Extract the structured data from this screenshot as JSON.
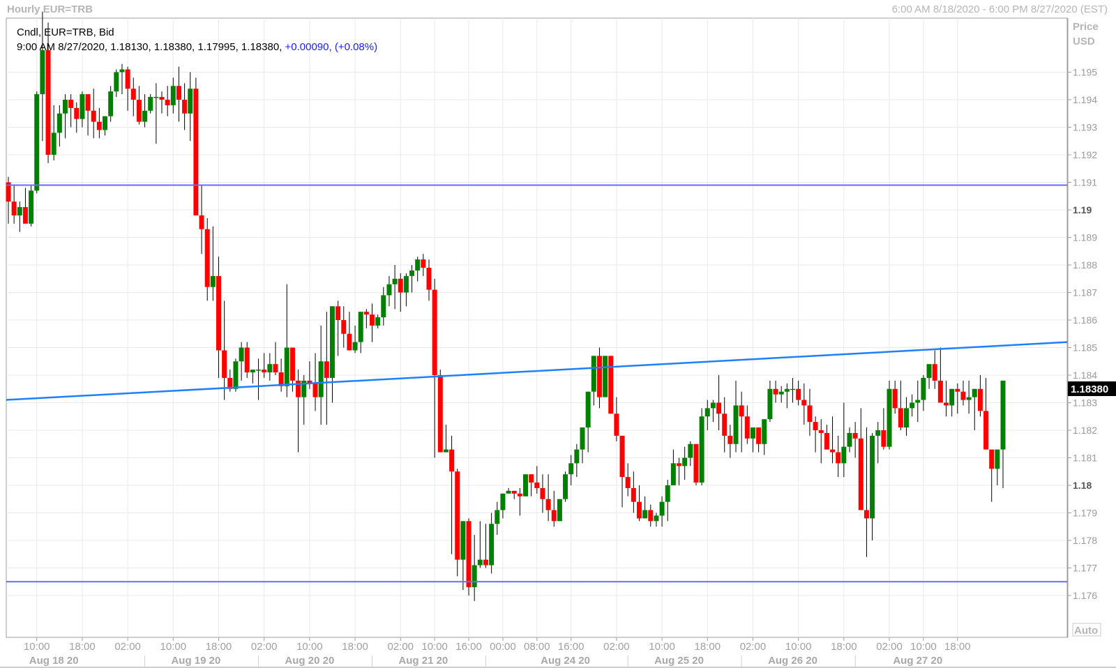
{
  "header": {
    "title": "Hourly EUR=TRB",
    "range": "6:00 AM 8/18/2020 - 6:00 PM 8/27/2020 (EST)"
  },
  "legend": {
    "line1": "Cndl, EUR=TRB, Bid",
    "line2_ohlc": "9:00 AM 8/27/2020, 1.18130, 1.18380, 1.17995, 1.18380,",
    "line2_change": "+0.00090, (+0.08%)"
  },
  "axis": {
    "price_label_1": "Price",
    "price_label_2": "USD",
    "auto_label": "Auto",
    "last_price": "1.18380"
  },
  "colors": {
    "up": "#008000",
    "down": "#ff0000",
    "hline": "#6a6aff",
    "trendline": "#1e7fff",
    "grid": "#e9e9e9"
  },
  "chart_data": {
    "type": "candlestick",
    "title": "Hourly EUR=TRB",
    "ylabel": "Price USD",
    "ylim": [
      1.1755,
      1.1963
    ],
    "y_ticks": [
      "1.195",
      "1.194",
      "1.193",
      "1.192",
      "1.191",
      "1.19",
      "1.189",
      "1.188",
      "1.187",
      "1.186",
      "1.185",
      "1.184",
      "1.183",
      "1.182",
      "1.181",
      "1.18",
      "1.179",
      "1.178",
      "1.177",
      "1.176"
    ],
    "x_time_labels": [
      "10:00",
      "18:00",
      "02:00",
      "10:00",
      "18:00",
      "02:00",
      "10:00",
      "18:00",
      "02:00",
      "10:00",
      "16:00",
      "00:00",
      "08:00",
      "16:00",
      "02:00",
      "10:00",
      "18:00",
      "02:00",
      "10:00",
      "18:00",
      "02:00",
      "10:00",
      "18:00"
    ],
    "x_date_labels": [
      "Aug 18 20",
      "Aug 19 20",
      "Aug 20 20",
      "Aug 21 20",
      "Aug 24 20",
      "Aug 25 20",
      "Aug 26 20",
      "Aug 27 20"
    ],
    "last_price": 1.1838,
    "horizontal_lines": [
      1.1909,
      1.1765
    ],
    "trendline": {
      "start": 1.1831,
      "end": 1.1852
    },
    "candles": [
      [
        1.191,
        1.1912,
        1.1895,
        1.1903
      ],
      [
        1.1903,
        1.1909,
        1.1895,
        1.1898
      ],
      [
        1.1898,
        1.1903,
        1.1892,
        1.1901
      ],
      [
        1.1901,
        1.1908,
        1.1896,
        1.1895
      ],
      [
        1.1895,
        1.1909,
        1.1894,
        1.1907
      ],
      [
        1.1907,
        1.1943,
        1.1906,
        1.1942
      ],
      [
        1.1942,
        1.1972,
        1.1925,
        1.1958
      ],
      [
        1.1958,
        1.1968,
        1.1917,
        1.192
      ],
      [
        1.192,
        1.1938,
        1.1918,
        1.1928
      ],
      [
        1.1928,
        1.1938,
        1.1923,
        1.1935
      ],
      [
        1.1935,
        1.1942,
        1.1926,
        1.194
      ],
      [
        1.194,
        1.1942,
        1.193,
        1.1937
      ],
      [
        1.1937,
        1.1939,
        1.1928,
        1.1933
      ],
      [
        1.1933,
        1.1943,
        1.193,
        1.1942
      ],
      [
        1.1942,
        1.1942,
        1.1927,
        1.1936
      ],
      [
        1.1936,
        1.1944,
        1.1926,
        1.1932
      ],
      [
        1.1932,
        1.1937,
        1.1926,
        1.1929
      ],
      [
        1.1929,
        1.1934,
        1.1927,
        1.1934
      ],
      [
        1.1934,
        1.1945,
        1.1932,
        1.1943
      ],
      [
        1.1943,
        1.1951,
        1.1941,
        1.195
      ],
      [
        1.195,
        1.1953,
        1.1942,
        1.1951
      ],
      [
        1.1951,
        1.1952,
        1.1936,
        1.1944
      ],
      [
        1.1944,
        1.1948,
        1.1934,
        1.194
      ],
      [
        1.194,
        1.1945,
        1.1931,
        1.1932
      ],
      [
        1.1932,
        1.1942,
        1.193,
        1.1936
      ],
      [
        1.1936,
        1.1942,
        1.1935,
        1.1941
      ],
      [
        1.1941,
        1.1946,
        1.1924,
        1.1941
      ],
      [
        1.1941,
        1.1943,
        1.1935,
        1.194
      ],
      [
        1.194,
        1.1945,
        1.1934,
        1.1938
      ],
      [
        1.1938,
        1.1948,
        1.1935,
        1.1945
      ],
      [
        1.1945,
        1.1952,
        1.1932,
        1.194
      ],
      [
        1.194,
        1.1946,
        1.1929,
        1.1935
      ],
      [
        1.1935,
        1.195,
        1.1925,
        1.1944
      ],
      [
        1.1944,
        1.1948,
        1.1901,
        1.1898
      ],
      [
        1.1898,
        1.1909,
        1.1884,
        1.1893
      ],
      [
        1.1893,
        1.1897,
        1.1867,
        1.1872
      ],
      [
        1.1872,
        1.1894,
        1.1867,
        1.1876
      ],
      [
        1.1876,
        1.1883,
        1.1839,
        1.1849
      ],
      [
        1.1849,
        1.1867,
        1.1831,
        1.1839
      ],
      [
        1.1839,
        1.1842,
        1.1834,
        1.1835
      ],
      [
        1.1835,
        1.1846,
        1.1834,
        1.1845
      ],
      [
        1.1845,
        1.1852,
        1.1838,
        1.185
      ],
      [
        1.185,
        1.1852,
        1.1839,
        1.1841
      ],
      [
        1.1841,
        1.1842,
        1.1837,
        1.1842
      ],
      [
        1.1842,
        1.1846,
        1.1831,
        1.1842
      ],
      [
        1.1842,
        1.1848,
        1.1839,
        1.1841
      ],
      [
        1.1841,
        1.1848,
        1.1838,
        1.1844
      ],
      [
        1.1844,
        1.1852,
        1.184,
        1.1841
      ],
      [
        1.1841,
        1.1846,
        1.1834,
        1.1836
      ],
      [
        1.1836,
        1.1873,
        1.1832,
        1.185
      ],
      [
        1.185,
        1.185,
        1.1834,
        1.1838
      ],
      [
        1.1838,
        1.1842,
        1.1812,
        1.1832
      ],
      [
        1.1832,
        1.184,
        1.1822,
        1.1838
      ],
      [
        1.1838,
        1.1845,
        1.1835,
        1.1837
      ],
      [
        1.1837,
        1.1848,
        1.1827,
        1.1832
      ],
      [
        1.1832,
        1.1858,
        1.1822,
        1.1845
      ],
      [
        1.1845,
        1.1863,
        1.1822,
        1.1839
      ],
      [
        1.1839,
        1.1856,
        1.183,
        1.1865
      ],
      [
        1.1865,
        1.1867,
        1.1847,
        1.186
      ],
      [
        1.186,
        1.1865,
        1.185,
        1.1855
      ],
      [
        1.1855,
        1.1863,
        1.185,
        1.1849
      ],
      [
        1.1849,
        1.1858,
        1.1848,
        1.1852
      ],
      [
        1.1852,
        1.1863,
        1.1848,
        1.1863
      ],
      [
        1.1863,
        1.1864,
        1.1857,
        1.1862
      ],
      [
        1.1862,
        1.1866,
        1.1852,
        1.1858
      ],
      [
        1.1858,
        1.1862,
        1.1857,
        1.1861
      ],
      [
        1.1861,
        1.1872,
        1.1858,
        1.1869
      ],
      [
        1.1869,
        1.1876,
        1.1865,
        1.1873
      ],
      [
        1.1873,
        1.188,
        1.1864,
        1.1875
      ],
      [
        1.1875,
        1.1877,
        1.1863,
        1.187
      ],
      [
        1.187,
        1.1877,
        1.1865,
        1.1876
      ],
      [
        1.1876,
        1.188,
        1.187,
        1.1878
      ],
      [
        1.1878,
        1.1883,
        1.1874,
        1.1882
      ],
      [
        1.1882,
        1.1884,
        1.1876,
        1.1879
      ],
      [
        1.1879,
        1.1882,
        1.1867,
        1.1871
      ],
      [
        1.1871,
        1.1875,
        1.181,
        1.184
      ],
      [
        1.184,
        1.1842,
        1.1815,
        1.1812
      ],
      [
        1.1812,
        1.1822,
        1.1818,
        1.1813
      ],
      [
        1.1813,
        1.1818,
        1.1775,
        1.1805
      ],
      [
        1.1805,
        1.1806,
        1.1767,
        1.1773
      ],
      [
        1.1773,
        1.1782,
        1.1762,
        1.1787
      ],
      [
        1.1787,
        1.1788,
        1.176,
        1.1763
      ],
      [
        1.1763,
        1.1782,
        1.1758,
        1.1771
      ],
      [
        1.1771,
        1.1787,
        1.177,
        1.1773
      ],
      [
        1.1773,
        1.1786,
        1.177,
        1.1771
      ],
      [
        1.1771,
        1.179,
        1.1768,
        1.1786
      ],
      [
        1.1786,
        1.1794,
        1.1782,
        1.1791
      ],
      [
        1.1791,
        1.1797,
        1.1788,
        1.1797
      ],
      [
        1.1797,
        1.1799,
        1.1797,
        1.1798
      ],
      [
        1.1798,
        1.1797,
        1.1795,
        1.1797
      ],
      [
        1.1797,
        1.1799,
        1.1789,
        1.1796
      ],
      [
        1.1796,
        1.1804,
        1.1796,
        1.1804
      ],
      [
        1.1804,
        1.1803,
        1.1796,
        1.1801
      ],
      [
        1.1801,
        1.1807,
        1.1797,
        1.1799
      ],
      [
        1.1799,
        1.1804,
        1.179,
        1.1795
      ],
      [
        1.1795,
        1.1804,
        1.1787,
        1.1791
      ],
      [
        1.1791,
        1.1798,
        1.1785,
        1.1787
      ],
      [
        1.1787,
        1.1795,
        1.1789,
        1.1795
      ],
      [
        1.1795,
        1.1805,
        1.1794,
        1.1804
      ],
      [
        1.1804,
        1.1811,
        1.18,
        1.1808
      ],
      [
        1.1808,
        1.1815,
        1.1803,
        1.1813
      ],
      [
        1.1813,
        1.182,
        1.1808,
        1.1821
      ],
      [
        1.1821,
        1.1829,
        1.1812,
        1.1834
      ],
      [
        1.1834,
        1.1839,
        1.1829,
        1.1847
      ],
      [
        1.1847,
        1.185,
        1.1828,
        1.1832
      ],
      [
        1.1832,
        1.1846,
        1.1836,
        1.1847
      ],
      [
        1.1847,
        1.1847,
        1.1826,
        1.1826
      ],
      [
        1.1826,
        1.1832,
        1.1816,
        1.1818
      ],
      [
        1.1818,
        1.1816,
        1.1792,
        1.1803
      ],
      [
        1.1803,
        1.1808,
        1.1796,
        1.1799
      ],
      [
        1.1799,
        1.1805,
        1.179,
        1.1794
      ],
      [
        1.1794,
        1.18,
        1.1787,
        1.1788
      ],
      [
        1.1788,
        1.1796,
        1.1788,
        1.1791
      ],
      [
        1.1791,
        1.1793,
        1.1785,
        1.1787
      ],
      [
        1.1787,
        1.179,
        1.1785,
        1.1789
      ],
      [
        1.1789,
        1.1796,
        1.1785,
        1.1794
      ],
      [
        1.1794,
        1.1802,
        1.1787,
        1.18
      ],
      [
        1.18,
        1.1813,
        1.18,
        1.1808
      ],
      [
        1.1808,
        1.181,
        1.18,
        1.1807
      ],
      [
        1.1807,
        1.1814,
        1.1802,
        1.181
      ],
      [
        1.181,
        1.1816,
        1.1807,
        1.1815
      ],
      [
        1.1815,
        1.1813,
        1.18,
        1.1801
      ],
      [
        1.1801,
        1.1828,
        1.18,
        1.1825
      ],
      [
        1.1825,
        1.1831,
        1.182,
        1.1828
      ],
      [
        1.1828,
        1.1831,
        1.1823,
        1.183
      ],
      [
        1.183,
        1.184,
        1.182,
        1.1826
      ],
      [
        1.1826,
        1.1832,
        1.1812,
        1.1818
      ],
      [
        1.1818,
        1.1822,
        1.181,
        1.1815
      ],
      [
        1.1815,
        1.1838,
        1.1812,
        1.1829
      ],
      [
        1.1829,
        1.1834,
        1.1812,
        1.1825
      ],
      [
        1.1825,
        1.1829,
        1.1815,
        1.1817
      ],
      [
        1.1817,
        1.182,
        1.1812,
        1.1821
      ],
      [
        1.1821,
        1.182,
        1.1812,
        1.1815
      ],
      [
        1.1815,
        1.1822,
        1.1811,
        1.1824
      ],
      [
        1.1824,
        1.1838,
        1.1823,
        1.1835
      ],
      [
        1.1835,
        1.1838,
        1.183,
        1.1833
      ],
      [
        1.1833,
        1.1836,
        1.183,
        1.1834
      ],
      [
        1.1834,
        1.1837,
        1.1828,
        1.1835
      ],
      [
        1.1835,
        1.1839,
        1.183,
        1.1835
      ],
      [
        1.1835,
        1.1838,
        1.1829,
        1.1831
      ],
      [
        1.1831,
        1.1837,
        1.1822,
        1.1829
      ],
      [
        1.1829,
        1.1835,
        1.1818,
        1.1823
      ],
      [
        1.1823,
        1.1825,
        1.1812,
        1.182
      ],
      [
        1.182,
        1.1824,
        1.1808,
        1.1819
      ],
      [
        1.1819,
        1.1822,
        1.1814,
        1.1813
      ],
      [
        1.1813,
        1.1825,
        1.1808,
        1.1812
      ],
      [
        1.1812,
        1.1818,
        1.1803,
        1.1808
      ],
      [
        1.1808,
        1.183,
        1.1803,
        1.1814
      ],
      [
        1.1814,
        1.1821,
        1.1812,
        1.1819
      ],
      [
        1.1819,
        1.1823,
        1.181,
        1.1817
      ],
      [
        1.1817,
        1.1828,
        1.1808,
        1.1791
      ],
      [
        1.1791,
        1.1821,
        1.1774,
        1.1788
      ],
      [
        1.1788,
        1.1819,
        1.178,
        1.1818
      ],
      [
        1.1818,
        1.1823,
        1.1808,
        1.182
      ],
      [
        1.182,
        1.1828,
        1.1813,
        1.1814
      ],
      [
        1.1814,
        1.1838,
        1.1813,
        1.1835
      ],
      [
        1.1835,
        1.1838,
        1.1826,
        1.1828
      ],
      [
        1.1828,
        1.1838,
        1.182,
        1.1821
      ],
      [
        1.1821,
        1.1832,
        1.1818,
        1.1828
      ],
      [
        1.1828,
        1.1833,
        1.1825,
        1.183
      ],
      [
        1.183,
        1.1838,
        1.1823,
        1.1831
      ],
      [
        1.1831,
        1.184,
        1.1827,
        1.1839
      ],
      [
        1.1839,
        1.1843,
        1.1835,
        1.1844
      ],
      [
        1.1844,
        1.1849,
        1.1835,
        1.1838
      ],
      [
        1.1838,
        1.185,
        1.1835,
        1.183
      ],
      [
        1.183,
        1.1838,
        1.1825,
        1.1829
      ],
      [
        1.1829,
        1.1835,
        1.1825,
        1.1835
      ],
      [
        1.1835,
        1.1837,
        1.1826,
        1.1834
      ],
      [
        1.1834,
        1.1838,
        1.1829,
        1.1831
      ],
      [
        1.1831,
        1.1838,
        1.1826,
        1.1832
      ],
      [
        1.1832,
        1.1835,
        1.182,
        1.1835
      ],
      [
        1.1835,
        1.184,
        1.1825,
        1.1827
      ],
      [
        1.1827,
        1.1839,
        1.1822,
        1.1813
      ],
      [
        1.1813,
        1.1812,
        1.1794,
        1.1806
      ],
      [
        1.1806,
        1.181,
        1.18,
        1.1813
      ],
      [
        1.1813,
        1.1838,
        1.1799,
        1.1838
      ]
    ]
  }
}
